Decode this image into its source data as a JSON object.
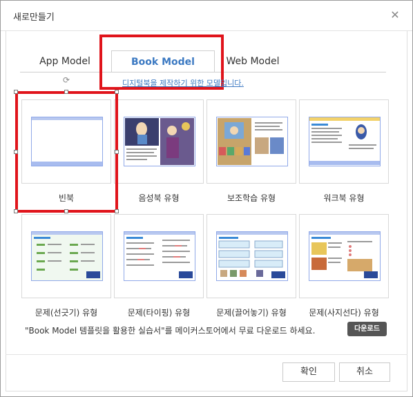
{
  "dialog": {
    "title": "새로만들기",
    "close_glyph": "✕"
  },
  "tabs": [
    {
      "label": "App Model"
    },
    {
      "label": "Book Model",
      "selected": true
    },
    {
      "label": "Web Model"
    }
  ],
  "description": "디지털북을 제작하기 위한 모델입니다.",
  "templates_row1": [
    {
      "label": "빈북"
    },
    {
      "label": "음성북 유형"
    },
    {
      "label": "보조학습 유형"
    },
    {
      "label": "워크북 유형"
    }
  ],
  "templates_row2": [
    {
      "label": "문제(선긋기) 유형"
    },
    {
      "label": "문제(타이핑) 유형"
    },
    {
      "label": "문제(끌어놓기) 유형"
    },
    {
      "label": "문제(사지선다) 유형"
    }
  ],
  "promo": {
    "text": "\"Book Model 템플릿을 활용한 실습서\"를 메이커스토어에서 무료 다운로드 하세요.",
    "download_label": "다운로드"
  },
  "footer": {
    "ok_label": "확인",
    "cancel_label": "취소"
  },
  "colors": {
    "accent": "#3b79c2",
    "highlight": "#e0141b",
    "page_border": "#8fa8e8"
  }
}
